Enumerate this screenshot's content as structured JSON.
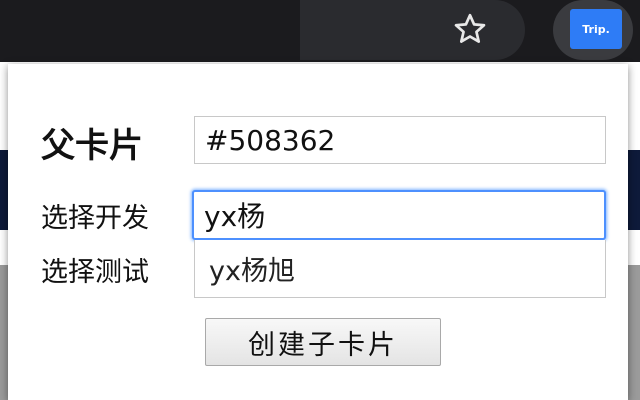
{
  "browser": {
    "bookmark_icon": "star-icon",
    "extension_label": "Trip."
  },
  "form": {
    "parent_card_label": "父卡片",
    "parent_card_value": "#508362",
    "select_dev_label": "选择开发",
    "select_dev_value": "yx杨",
    "select_test_label": "选择测试",
    "suggestion": "yx杨旭",
    "create_button_label": "创建子卡片"
  },
  "colors": {
    "focus_ring": "#4d90fe",
    "extension_brand": "#2e7cf6"
  }
}
